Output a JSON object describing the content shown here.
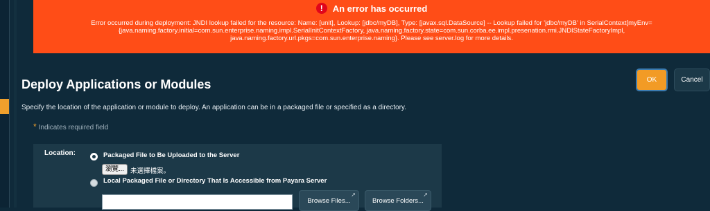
{
  "error": {
    "title": "An error has occurred",
    "icon": "exclamation-icon",
    "message": "Error occurred during deployment: JNDI lookup failed for the resource: Name: [unit], Lookup: [jdbc/myDB], Type: [javax.sql.DataSource] -- Lookup failed for 'jdbc/myDB' in SerialContext[myEnv={java.naming.factory.initial=com.sun.enterprise.naming.impl.SerialInitContextFactory, java.naming.factory.state=com.sun.corba.ee.impl.presenation.rmi.JNDIStateFactoryImpl, java.naming.factory.url.pkgs=com.sun.enterprise.naming}. Please see server.log for more details.",
    "color": "#ff4d17"
  },
  "page": {
    "title": "Deploy Applications or Modules",
    "description": "Specify the location of the application or module to deploy. An application can be in a packaged file or specified as a directory.",
    "required_marker": "*",
    "required_note": "Indicates required field"
  },
  "actions": {
    "ok_label": "OK",
    "cancel_label": "Cancel",
    "accent": "#f29b25"
  },
  "form": {
    "location_label": "Location:",
    "option_upload": {
      "label": "Packaged File to Be Uploaded to the Server",
      "selected": true,
      "browse_label": "瀏覽...",
      "no_file_text": "未選擇檔案。"
    },
    "option_local": {
      "label": "Local Packaged File or Directory That Is Accessible from Payara Server",
      "selected": false,
      "path_value": "",
      "browse_files_label": "Browse Files...",
      "browse_folders_label": "Browse Folders...",
      "external_icon": "external-link-icon"
    }
  }
}
